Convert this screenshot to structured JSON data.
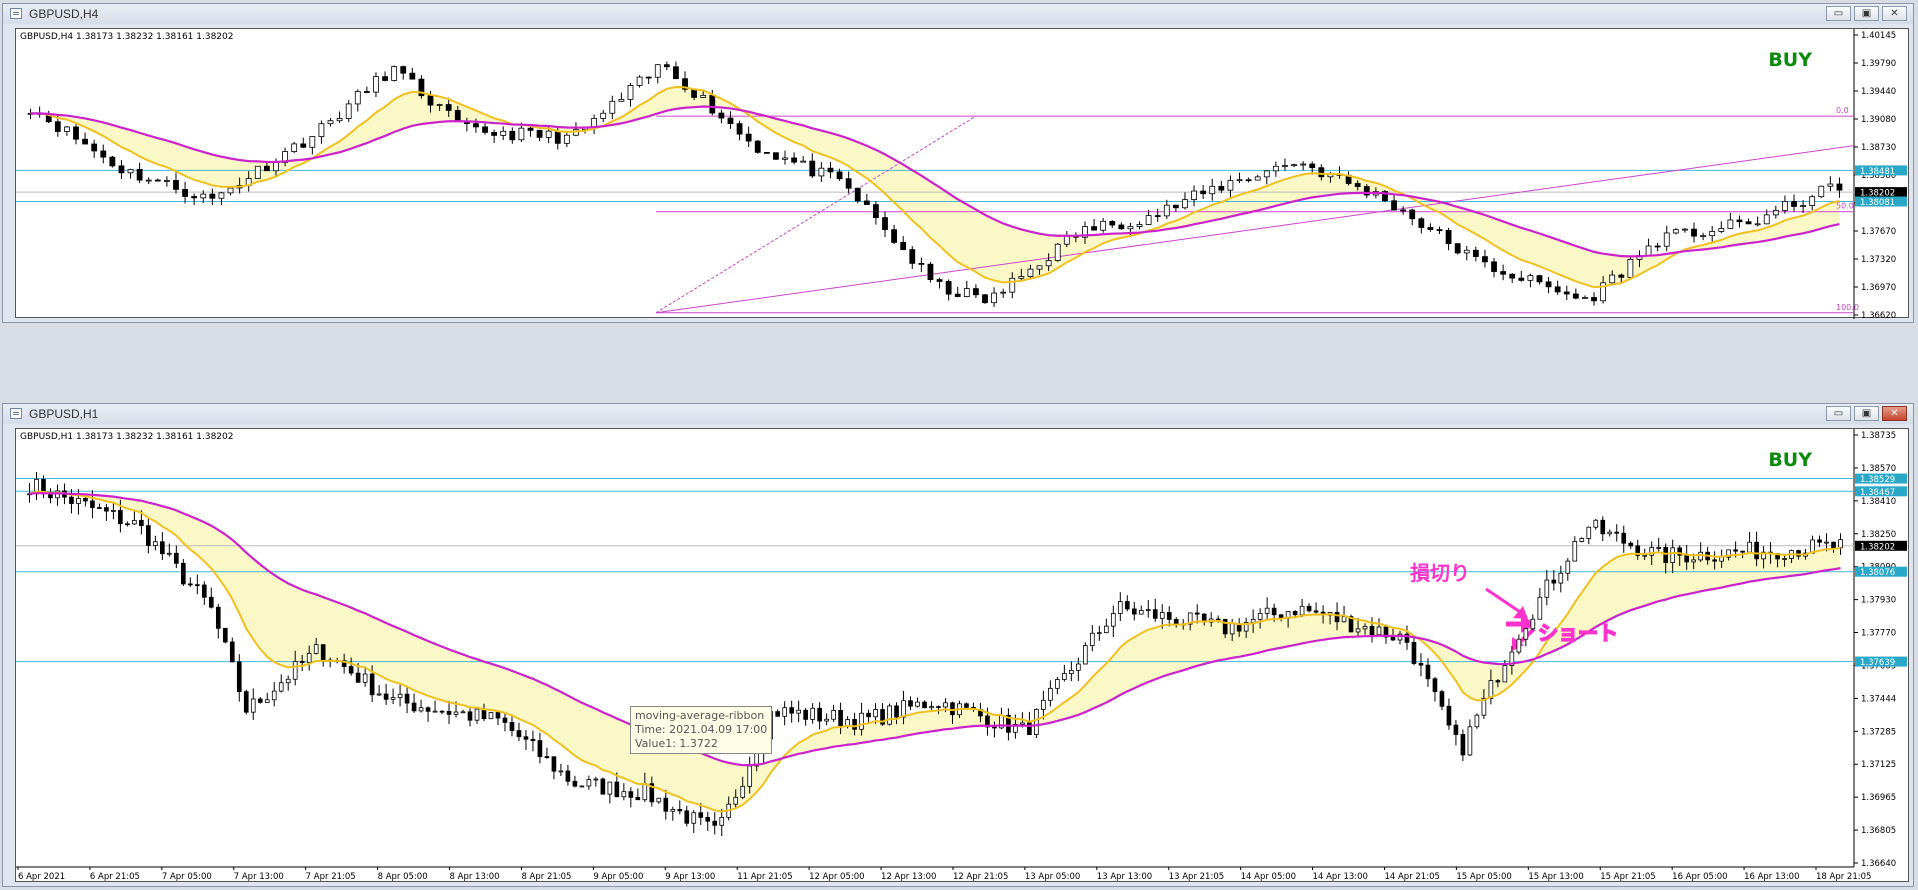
{
  "windows": [
    {
      "title": "GBPUSD,H4",
      "info": "GBPUSD,H4 1.38173 1.38232 1.38161 1.38202",
      "signal": "BUY",
      "price_labels": [
        "1.40145",
        "1.39790",
        "1.39440",
        "1.39080",
        "1.38730",
        "1.38380",
        "1.38030",
        "1.37670",
        "1.37320",
        "1.36970",
        "1.36620"
      ],
      "highlight_prices": [
        {
          "value": "1.38481",
          "bg": "#2aa8c8",
          "fg": "#ffffff"
        },
        {
          "value": "1.38202",
          "bg": "#000000",
          "fg": "#ffffff"
        },
        {
          "value": "1.38081",
          "bg": "#2aa8c8",
          "fg": "#ffffff"
        }
      ],
      "fib_labels": [
        "0.0",
        "50.0",
        "100.0"
      ],
      "time_labels": [],
      "controls": {
        "minimize": "▭",
        "restore": "▣",
        "close": "✕"
      },
      "colors": {
        "fast_ma": "#f0c020",
        "slow_ma": "#cc22cc",
        "ribbon": "#fbf8c8",
        "hline": "#40b8d8",
        "fib": "#cc44cc"
      }
    },
    {
      "title": "GBPUSD,H1",
      "info": "GBPUSD,H1 1.38173 1.38232 1.38161 1.38202",
      "signal": "BUY",
      "price_labels": [
        "1.38735",
        "1.38570",
        "1.38410",
        "1.38250",
        "1.38090",
        "1.37930",
        "1.37770",
        "1.37605",
        "1.37444",
        "1.37285",
        "1.37125",
        "1.36965",
        "1.36805",
        "1.36640"
      ],
      "highlight_prices": [
        {
          "value": "1.38529",
          "bg": "#2aa8c8",
          "fg": "#ffffff"
        },
        {
          "value": "1.38467",
          "bg": "#2aa8c8",
          "fg": "#ffffff"
        },
        {
          "value": "1.38202",
          "bg": "#000000",
          "fg": "#ffffff"
        },
        {
          "value": "1.38076",
          "bg": "#2aa8c8",
          "fg": "#ffffff"
        },
        {
          "value": "1.37639",
          "bg": "#2aa8c8",
          "fg": "#ffffff"
        }
      ],
      "time_labels": [
        "6 Apr 2021",
        "6 Apr 21:05",
        "7 Apr 05:00",
        "7 Apr 13:00",
        "7 Apr 21:05",
        "8 Apr 05:00",
        "8 Apr 13:00",
        "8 Apr 21:05",
        "9 Apr 05:00",
        "9 Apr 13:00",
        "11 Apr 21:05",
        "12 Apr 05:00",
        "12 Apr 13:00",
        "12 Apr 21:05",
        "13 Apr 05:00",
        "13 Apr 13:00",
        "13 Apr 21:05",
        "14 Apr 05:00",
        "14 Apr 13:00",
        "14 Apr 21:05",
        "15 Apr 05:00",
        "15 Apr 13:00",
        "15 Apr 21:05",
        "16 Apr 05:00",
        "16 Apr 13:00",
        "18 Apr 21:05"
      ],
      "tooltip": {
        "name": "moving-average-ribbon",
        "time": "Time: 2021.04.09 17:00",
        "value": "Value1: 1.3722"
      },
      "annotations": {
        "stop_loss": "損切り",
        "short": "ショート"
      },
      "controls": {
        "minimize": "▭",
        "restore": "▣",
        "close": "✕"
      },
      "colors": {
        "fast_ma": "#f0c020",
        "slow_ma": "#cc22cc",
        "ribbon": "#fbf8c8",
        "hline": "#40b8d8",
        "annotation": "#ff33cc"
      }
    }
  ]
}
